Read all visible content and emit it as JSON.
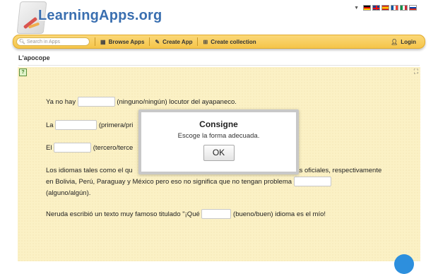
{
  "header": {
    "site_title": "LearningApps.org",
    "languages": [
      "de",
      "en",
      "es",
      "fr",
      "it",
      "ru"
    ]
  },
  "nav": {
    "search_placeholder": "Search in Apps",
    "browse_label": "Browse Apps",
    "create_label": "Create App",
    "collection_label": "Create collection",
    "login_label": "Login"
  },
  "page": {
    "heading": "L'apocope"
  },
  "exercise": {
    "l1_before": "Ya no hay",
    "l1_after": "(ninguno/ningún) locutor del ayapaneco.",
    "l2_before": "La",
    "l2_after": "(primera/pri",
    "l3_before": "El",
    "l3_after": "(tercero/terce",
    "l4_before": "Los idiomas tales como el qu",
    "l4_mid": "gas oficiales, respectivamente",
    "l4_line2": "en Bolivia, Perú, Paraguay y México pero eso no significa que no tengan problema",
    "l4_line3": "(alguno/algún).",
    "l5_before": "Neruda escribió un texto muy famoso titulado \"¡Qué",
    "l5_after": "(bueno/buen) idioma es el mío!"
  },
  "modal": {
    "title": "Consigne",
    "message": "Escoge la forma adecuada.",
    "ok_label": "OK"
  },
  "colors": {
    "brand_blue": "#3a6fb0",
    "nav_yellow": "#f5c54a",
    "app_background": "#fbf1c5"
  }
}
